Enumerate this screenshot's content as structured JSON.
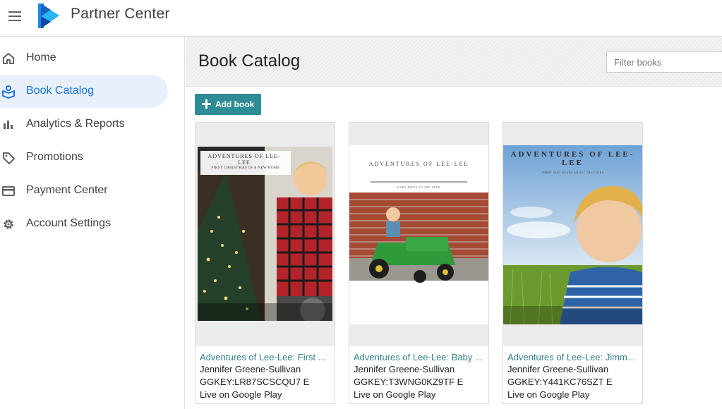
{
  "app": {
    "title": "Partner Center"
  },
  "sidebar": {
    "items": [
      {
        "label": "Home",
        "icon": "home-icon",
        "active": false
      },
      {
        "label": "Book Catalog",
        "icon": "book-catalog-icon",
        "active": true
      },
      {
        "label": "Analytics & Reports",
        "icon": "bar-chart-icon",
        "active": false
      },
      {
        "label": "Promotions",
        "icon": "tag-icon",
        "active": false
      },
      {
        "label": "Payment Center",
        "icon": "credit-card-icon",
        "active": false
      },
      {
        "label": "Account Settings",
        "icon": "gear-icon",
        "active": false
      }
    ]
  },
  "header": {
    "title": "Book Catalog",
    "filter_placeholder": "Filter books"
  },
  "toolbar": {
    "add_label": "Add book"
  },
  "books": [
    {
      "title": "Adventures of Lee-Lee: First ...",
      "author": "Jennifer Greene-Sullivan",
      "id": "GGKEY:LR87SCSCQU7 E",
      "status": "Live on Google Play",
      "cover_heading": "ADVENTURES OF LEE-LEE",
      "cover_subtitle": "FIRST CHRISTMAS IN A NEW HOME"
    },
    {
      "title": "Adventures of Lee-Lee: Baby ...",
      "author": "Jennifer Greene-Sullivan",
      "id": "GGKEY:T3WNG0KZ9TF E",
      "status": "Live on Google Play",
      "cover_heading": "ADVENTURES OF LEE-LEE",
      "cover_subtitle": "BABY RIDES TO THE PARK"
    },
    {
      "title": "Adventures of Lee-Lee: Jimmy...",
      "author": "Jennifer Greene-Sullivan",
      "id": "GGKEY:Y441KC76SZT E",
      "status": "Live on Google Play",
      "cover_heading": "ADVENTURES OF LEE-LEE",
      "cover_subtitle": "JIMMY MAC READS ABOUT TRACTORS"
    }
  ],
  "colors": {
    "accent": "#1a73e8",
    "add_button": "#2d8c95",
    "link": "#2f7f8c",
    "active_bg": "#e8f0fe"
  }
}
